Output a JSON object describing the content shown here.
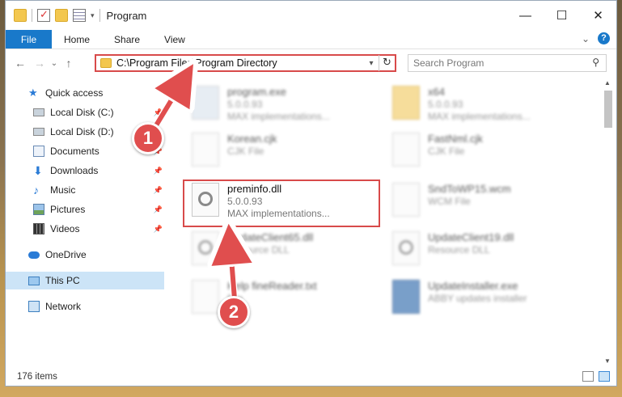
{
  "window": {
    "title": "Program",
    "controls": {
      "minimize": "—",
      "maximize": "☐",
      "close": "✕"
    }
  },
  "ribbon": {
    "tabs": [
      "File",
      "Home",
      "Share",
      "View"
    ],
    "help": "?",
    "expand": "⌄"
  },
  "nav": {
    "back": "←",
    "forward": "→",
    "recent": "⌄",
    "up": "↑",
    "address": "C:\\Program Files\\Program Directory",
    "refresh": "↻",
    "search_placeholder": "Search Program",
    "search_icon": "magnifier-icon"
  },
  "sidebar": {
    "items": [
      {
        "label": "Quick access",
        "icon": "star-icon"
      },
      {
        "label": "Local Disk (C:)",
        "icon": "disk-icon",
        "pinned": true
      },
      {
        "label": "Local Disk (D:)",
        "icon": "disk-icon",
        "pinned": true
      },
      {
        "label": "Documents",
        "icon": "documents-icon",
        "pinned": true
      },
      {
        "label": "Downloads",
        "icon": "downloads-icon",
        "pinned": true
      },
      {
        "label": "Music",
        "icon": "music-icon",
        "pinned": true
      },
      {
        "label": "Pictures",
        "icon": "pictures-icon",
        "pinned": true
      },
      {
        "label": "Videos",
        "icon": "videos-icon",
        "pinned": true
      },
      {
        "label": "OneDrive",
        "icon": "cloud-icon"
      },
      {
        "label": "This PC",
        "icon": "pc-icon",
        "selected": true
      },
      {
        "label": "Network",
        "icon": "network-icon"
      }
    ],
    "pin_glyph": "📌"
  },
  "files": [
    {
      "name": "program.exe",
      "sub1": "5.0.0.93",
      "sub2": "MAX implementations..."
    },
    {
      "name": "x64",
      "sub1": "5.0.0.93",
      "sub2": "MAX implementations..."
    },
    {
      "name": "Korean.cjk",
      "sub1": "CJK File",
      "sub2": ""
    },
    {
      "name": "FastNml.cjk",
      "sub1": "CJK File",
      "sub2": ""
    },
    {
      "name": "preminfo.dll",
      "sub1": "5.0.0.93",
      "sub2": "MAX implementations..."
    },
    {
      "name": "SndToWP15.wcm",
      "sub1": "WCM File",
      "sub2": ""
    },
    {
      "name": "UpdateClient65.dll",
      "sub1": "Resource DLL",
      "sub2": ""
    },
    {
      "name": "UpdateClient19.dll",
      "sub1": "Resource DLL",
      "sub2": ""
    },
    {
      "name": "Help fineReader.txt",
      "sub1": "File",
      "sub2": ""
    },
    {
      "name": "UpdateInstaller.exe",
      "sub1": "ABBY updates installer",
      "sub2": ""
    }
  ],
  "status": {
    "items": "176 items"
  },
  "callouts": [
    "1",
    "2"
  ],
  "colors": {
    "accent": "#1979ca",
    "highlight": "#d84a4a",
    "selected": "#cce4f7"
  }
}
